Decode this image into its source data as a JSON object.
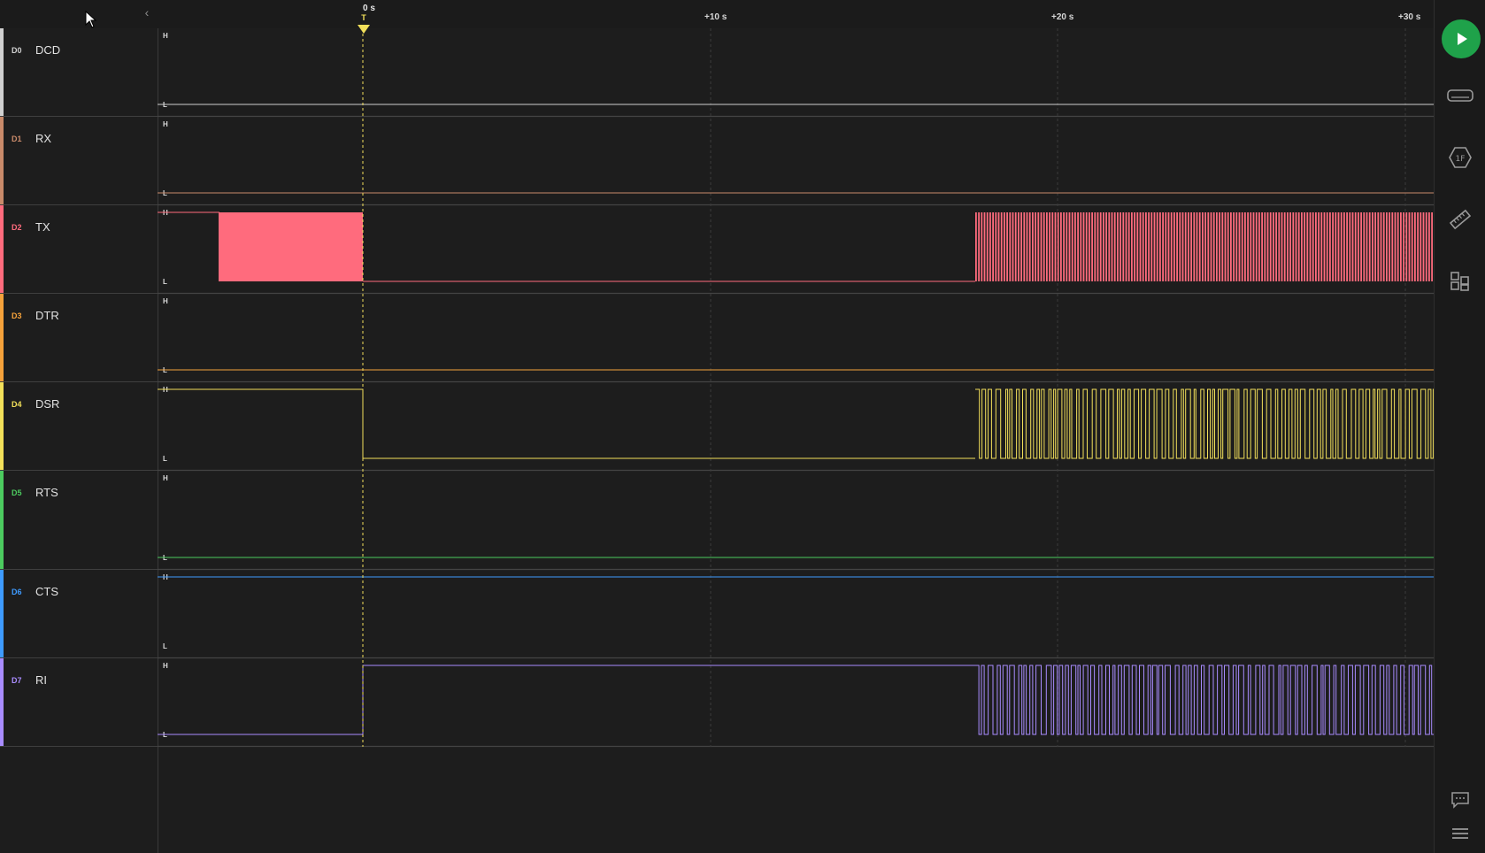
{
  "ruler": {
    "trigger_time": "0 s",
    "trigger_flag": "T",
    "ticks": [
      "+10 s",
      "+20 s",
      "+30 s"
    ]
  },
  "level_labels": {
    "high": "H",
    "low": "L"
  },
  "channels": [
    {
      "idx": "D0",
      "name": "DCD",
      "color": "#d0d0d0"
    },
    {
      "idx": "D1",
      "name": "RX",
      "color": "#c98a6a"
    },
    {
      "idx": "D2",
      "name": "TX",
      "color": "#ff6b7d"
    },
    {
      "idx": "D3",
      "name": "DTR",
      "color": "#f5a23b"
    },
    {
      "idx": "D4",
      "name": "DSR",
      "color": "#f2e05a"
    },
    {
      "idx": "D5",
      "name": "RTS",
      "color": "#4ccb5f"
    },
    {
      "idx": "D6",
      "name": "CTS",
      "color": "#3e9bff"
    },
    {
      "idx": "D7",
      "name": "RI",
      "color": "#a98cff"
    }
  ],
  "toolbar": {
    "play_icon": "play-icon",
    "icons": [
      "channel-view-icon",
      "analyzer-icon",
      "measure-ruler-icon",
      "extensions-icon",
      "notes-icon",
      "menu-icon"
    ]
  },
  "colors": {
    "background": "#1d1d1d",
    "trigger": "#f2e05a",
    "play": "#1fa24a"
  }
}
